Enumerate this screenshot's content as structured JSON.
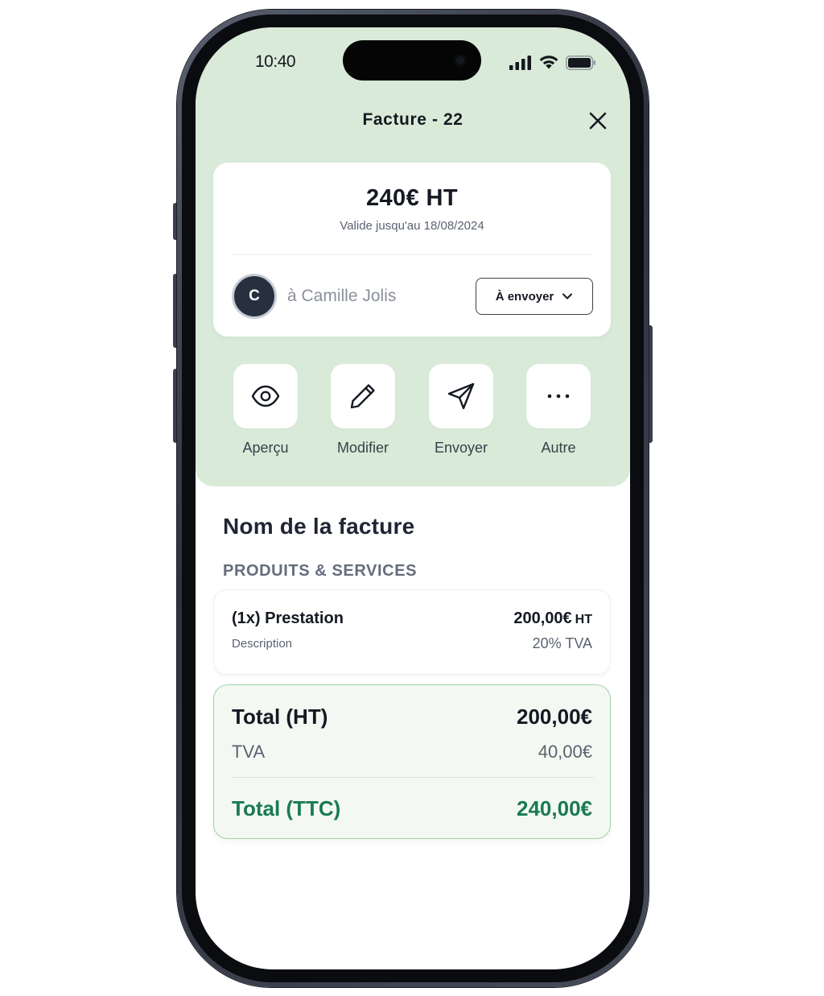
{
  "status_bar": {
    "time": "10:40",
    "icons": [
      "cellular-signal-icon",
      "wifi-icon",
      "battery-icon"
    ]
  },
  "header": {
    "title": "Facture - 22",
    "close_icon": "close-icon"
  },
  "summary": {
    "amount": "240€ HT",
    "validity": "Valide jusqu'au 18/08/2024",
    "avatar_initial": "C",
    "recipient": "à Camille Jolis",
    "status": "À envoyer"
  },
  "actions": [
    {
      "label": "Aperçu",
      "icon": "eye-icon"
    },
    {
      "label": "Modifier",
      "icon": "pencil-icon"
    },
    {
      "label": "Envoyer",
      "icon": "send-icon"
    },
    {
      "label": "Autre",
      "icon": "more-icon"
    }
  ],
  "invoice": {
    "name": "Nom de la facture",
    "section": "PRODUITS & SERVICES",
    "items": [
      {
        "name": "(1x) Prestation",
        "description": "Description",
        "price": "200,00€",
        "price_unit": "HT",
        "tax": "20% TVA"
      }
    ]
  },
  "totals": {
    "ht_label": "Total (HT)",
    "ht_value": "200,00€",
    "tva_label": "TVA",
    "tva_value": "40,00€",
    "ttc_label": "Total (TTC)",
    "ttc_value": "240,00€"
  },
  "colors": {
    "header_background": "#d9ead8",
    "accent_green": "#1a7a52",
    "totals_border": "#9fd3a7"
  }
}
